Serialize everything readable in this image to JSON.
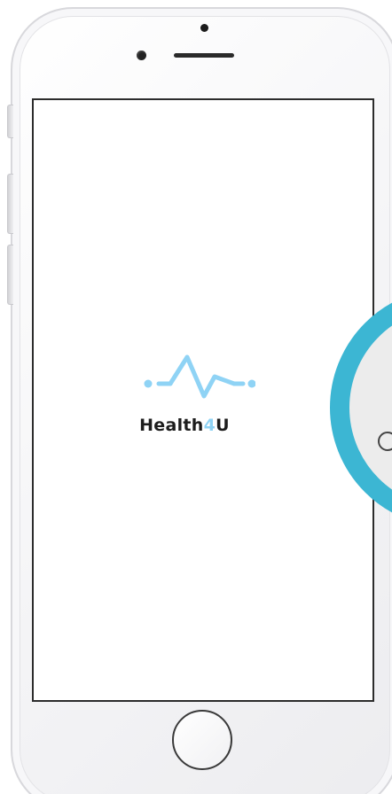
{
  "app": {
    "brand_text": "Health",
    "brand_accent": "4",
    "brand_suffix": "U",
    "logo_icon": "heartbeat-pulse-icon"
  },
  "colors": {
    "brand_accent": "#8fd3f5",
    "ring": "#3cb6d3"
  },
  "device": {
    "model_icon": "smartphone-frame",
    "home_button_icon": "home-button"
  }
}
